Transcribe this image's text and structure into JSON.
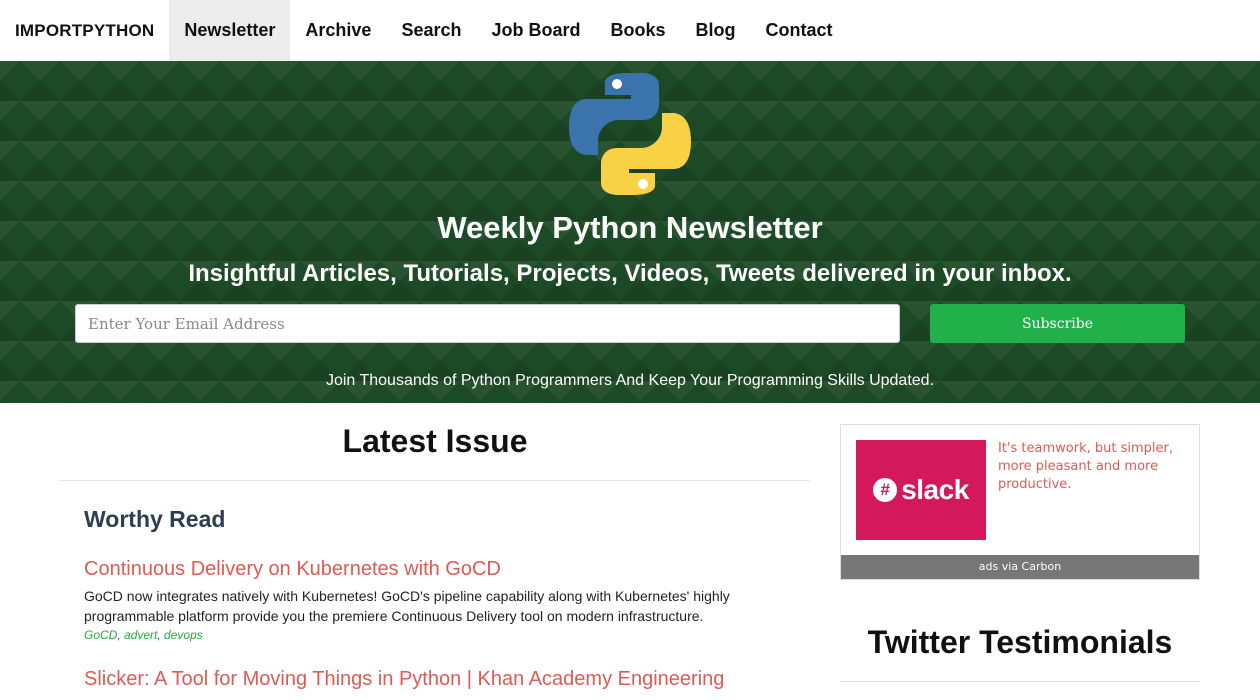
{
  "nav": {
    "brand": "IMPORTPYTHON",
    "items": [
      {
        "label": "Newsletter",
        "active": true
      },
      {
        "label": "Archive"
      },
      {
        "label": "Search"
      },
      {
        "label": "Job Board"
      },
      {
        "label": "Books"
      },
      {
        "label": "Blog"
      },
      {
        "label": "Contact"
      }
    ]
  },
  "hero": {
    "logo_icon": "python-logo-icon",
    "title": "Weekly Python Newsletter",
    "subtitle": "Insightful Articles, Tutorials, Projects, Videos, Tweets delivered in your inbox.",
    "email_placeholder": "Enter Your Email Address",
    "email_value": "",
    "subscribe_label": "Subscribe",
    "note": "Join Thousands of Python Programmers And Keep Your Programming Skills Updated."
  },
  "main": {
    "title": "Latest Issue",
    "section": "Worthy Read",
    "articles": [
      {
        "title": "Continuous Delivery on Kubernetes with GoCD",
        "description": "GoCD now integrates natively with Kubernetes! GoCD's pipeline capability along with Kubernetes' highly programmable platform provide you the premiere Continuous Delivery tool on modern infrastructure.",
        "tags": [
          "GoCD",
          "advert",
          "devops"
        ]
      },
      {
        "title": "Slicker: A Tool for Moving Things in Python | Khan Academy Engineering"
      }
    ]
  },
  "sidebar": {
    "ad": {
      "image_word": "slack",
      "image_symbol": "#",
      "text": "It's teamwork, but simpler, more pleasant and more productive.",
      "footer": "ads via Carbon"
    },
    "twitter_title": "Twitter Testimonials"
  },
  "colors": {
    "hero_bg": "#1d4a26",
    "subscribe": "#22b04b",
    "link": "#e05a54",
    "tag": "#2aaa3a",
    "slack": "#d4185c"
  }
}
